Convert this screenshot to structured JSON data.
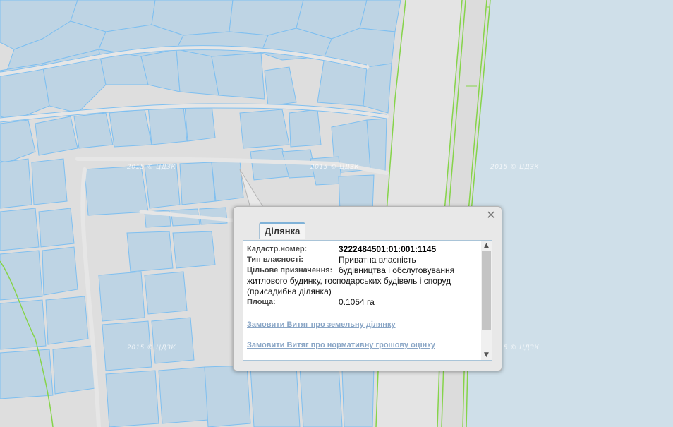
{
  "map": {
    "watermark": "2015 © ЦДЗК",
    "colors": {
      "water": "#cfdfe9",
      "parcel_fill": "#bed4e4",
      "parcel_border": "#7ebff0",
      "road": "#e2e2e2",
      "green_line": "#86d44a"
    }
  },
  "popup": {
    "tab_label": "Ділянка",
    "close_icon": "close-icon",
    "fields": {
      "cadastre_label": "Кадастр.номер:",
      "cadastre_value": "3222484501:01:001:1145",
      "ownership_label": "Тип власності:",
      "ownership_value": "Приватна власність",
      "purpose_label": "Цільове призначення:",
      "purpose_value_line1": "будівництва і обслуговування",
      "purpose_value_rest": "житлового будинку, господарських будівель і споруд (присадибна ділянка)",
      "area_label": "Площа:",
      "area_value": "0.1054 га"
    },
    "links": {
      "order_extract": "Замовити Витяг про земельну ділянку",
      "order_valuation": "Замовити Витяг про нормативну грошову оцінку"
    },
    "scroll": {
      "up_icon": "▲",
      "down_icon": "▼"
    }
  }
}
